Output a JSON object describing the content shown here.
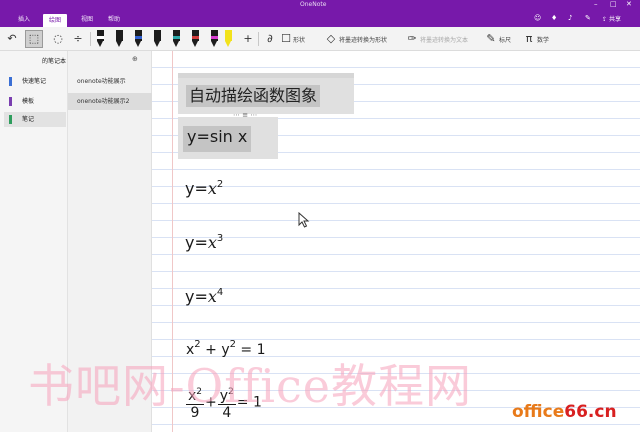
{
  "window": {
    "title": "OneNote",
    "controls": [
      "–",
      "□",
      "✕"
    ]
  },
  "ribbon": {
    "tabs": [
      {
        "label": "插入"
      },
      {
        "label": "绘图"
      },
      {
        "label": "视图"
      },
      {
        "label": "帮助"
      }
    ],
    "active_tab": "绘图",
    "share_label": "共享"
  },
  "toolbar": {
    "shape_label": "形状",
    "ink_to_shape_label": "将墨迹转换为形状",
    "ink_to_text_label": "将墨迹转换为文本",
    "ruler_label": "标尺",
    "math_label": "数学",
    "pen_colors": [
      "#1c1c1c",
      "#1c1c1c",
      "#2f5fd0",
      "#1c1c1c",
      "#2aa8a8",
      "#d03a3a",
      "#d63ccf",
      "#f2e21b"
    ]
  },
  "notebook": {
    "name": "的笔记本",
    "sections": [
      {
        "label": "快速笔记",
        "color": "#3b6fd4"
      },
      {
        "label": "模板",
        "color": "#7a3fb0"
      },
      {
        "label": "笔记",
        "color": "#2e9d5d"
      }
    ]
  },
  "pages": [
    {
      "label": "onenote功能展示"
    },
    {
      "label": "onenote功能展示2"
    }
  ],
  "canvas": {
    "title": "自动描绘函数图象",
    "equations": [
      {
        "text": "y=sin x"
      },
      {
        "lhs": "y=",
        "var": "x",
        "exp": "2"
      },
      {
        "lhs": "y=",
        "var": "x",
        "exp": "3"
      },
      {
        "lhs": "y=",
        "var": "x",
        "exp": "4"
      },
      {
        "a": "x",
        "a_exp": "2",
        "op": " + ",
        "b": "y",
        "b_exp": "2",
        "rhs": " = 1"
      },
      {
        "num1": "x",
        "num1_exp": "2",
        "den1": "9",
        "op": "+",
        "num2": "y",
        "num2_exp": "2",
        "den2": "4",
        "rhs": "= 1"
      }
    ]
  },
  "watermark": {
    "text": "书吧网-Office教程网",
    "logo": "office66.cn",
    "logo_colors": [
      "#e87a1a",
      "#d82020"
    ]
  }
}
